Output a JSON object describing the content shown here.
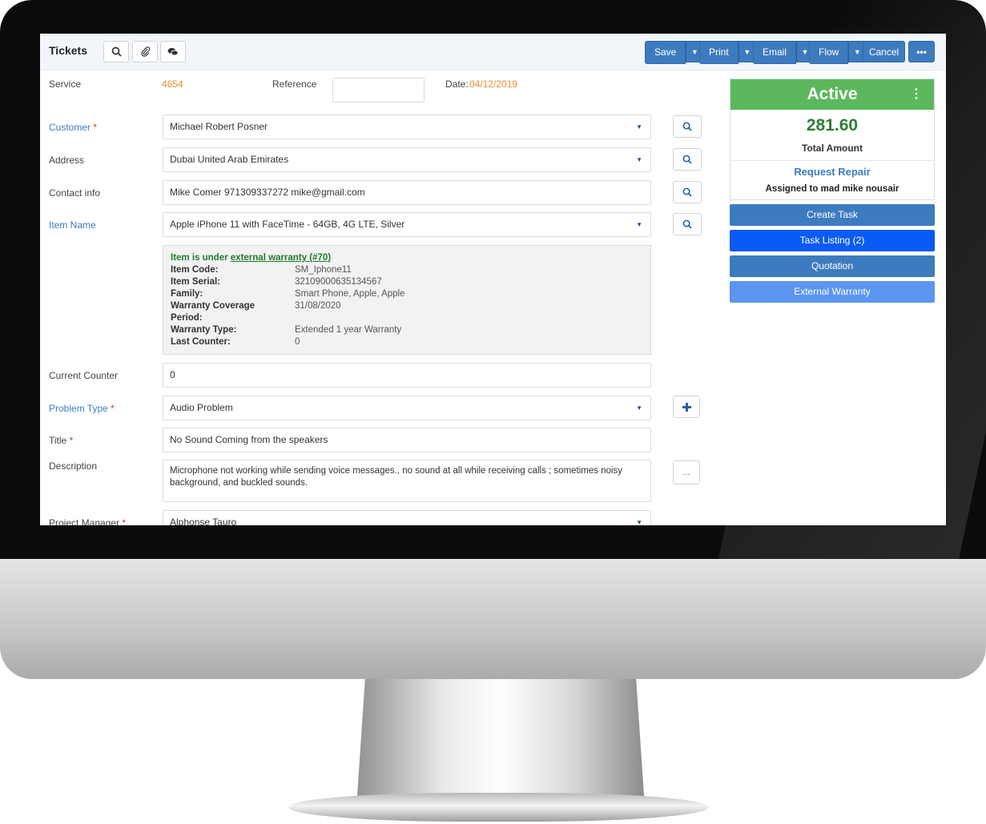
{
  "toolbar": {
    "title": "Tickets",
    "save_label": "Save",
    "print_label": "Print",
    "email_label": "Email",
    "flow_label": "Flow",
    "cancel_label": "Cancel",
    "more_label": "•••"
  },
  "header": {
    "service_label": "Service",
    "service_value": "4654",
    "reference_label": "Reference",
    "reference_value": "",
    "date_label": "Date:",
    "date_value": "04/12/2019"
  },
  "form": {
    "customer_label": "Customer",
    "customer_value": "Michael Robert Posner",
    "address_label": "Address",
    "address_value": "Dubai United Arab Emirates",
    "contact_label": "Contact info",
    "contact_value": "Mike Comer 971309337272 mike@gmail.com",
    "item_label": "Item Name",
    "item_value": "Apple iPhone 11 with FaceTime - 64GB, 4G LTE, Silver",
    "counter_label": "Current Counter",
    "counter_value": "0",
    "problem_label": "Problem Type",
    "problem_value": "Audio Problem",
    "title_label": "Title",
    "title_value": "No Sound Coming from the speakers",
    "description_label": "Description",
    "description_value": "Microphone not working while sending voice messages., no sound at all while receiving calls ; sometimes noisy background, and buckled sounds.",
    "description_more": "...",
    "pm_label": "Project Manager",
    "pm_value": "Alphonse Tauro",
    "required_mark": "*"
  },
  "warranty": {
    "prefix": "Item is under ",
    "link": "external warranty (#70)",
    "rows": [
      {
        "key": "Item Code:",
        "value": "SM_Iphone11"
      },
      {
        "key": "Item Serial:",
        "value": "32109000635134567"
      },
      {
        "key": "Family:",
        "value": "Smart Phone, Apple, Apple"
      },
      {
        "key": "Warranty Coverage",
        "value": "31/08/2020"
      },
      {
        "key": "Period:",
        "value": ""
      },
      {
        "key": "Warranty Type:",
        "value": "Extended 1 year Warranty"
      },
      {
        "key": "Last Counter:",
        "value": "0"
      }
    ]
  },
  "side": {
    "status": "Active",
    "amount": "281.60",
    "amount_label": "Total Amount",
    "request_link": "Request Repair",
    "assigned": "Assigned to mad mike nousair",
    "buttons": [
      {
        "label": "Create Task",
        "color": "#3d7bbf"
      },
      {
        "label": "Task Listing (2)",
        "color": "#0a5bf5"
      },
      {
        "label": "Quotation",
        "color": "#3d7bbf"
      },
      {
        "label": "External Warranty",
        "color": "#5b95f0"
      }
    ]
  },
  "colors": {
    "accent": "#3d7bbf",
    "status_green": "#5cb85c",
    "amount_green": "#2e7d32",
    "orange": "#f08b2c"
  }
}
